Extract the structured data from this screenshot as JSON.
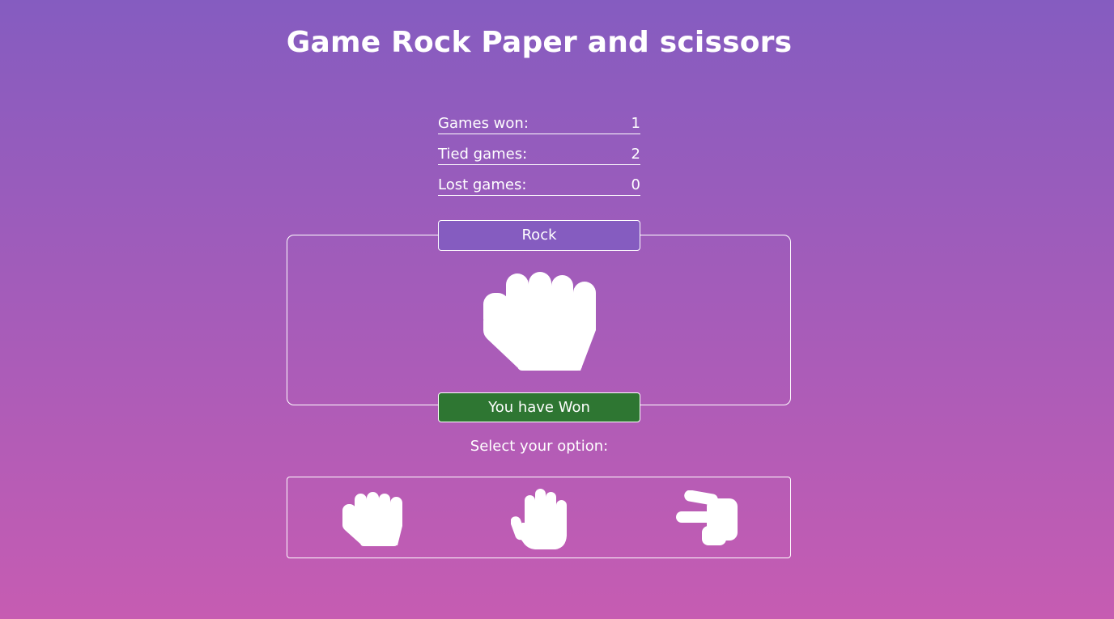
{
  "title": "Game Rock Paper and scissors",
  "scores": {
    "won_label": "Games won:",
    "won_value": "1",
    "tied_label": "Tied games:",
    "tied_value": "2",
    "lost_label": "Lost games:",
    "lost_value": "0"
  },
  "round": {
    "choice": "Rock",
    "choice_icon": "rock-hand-icon",
    "result": "You have Won",
    "result_color": "#2e7632"
  },
  "prompt": "Select your option:",
  "options": [
    {
      "icon": "rock-hand-icon"
    },
    {
      "icon": "paper-hand-icon"
    },
    {
      "icon": "scissors-hand-icon"
    }
  ],
  "colors": {
    "background_top": "#855cc0",
    "background_bottom": "#c65cb2",
    "choice_label_bg": "#855cc0"
  }
}
